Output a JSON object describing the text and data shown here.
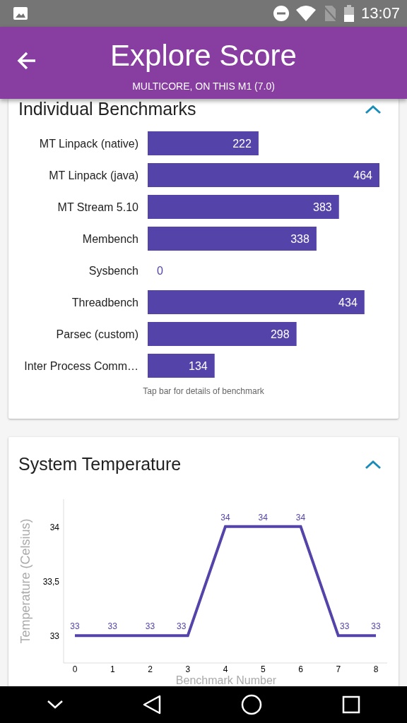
{
  "status_bar": {
    "time": "13:07"
  },
  "app_bar": {
    "title": "Explore Score",
    "subtitle": "MULTICORE, ON THIS M1 (7.0)"
  },
  "benchmarks_card": {
    "title": "Individual Benchmarks",
    "expanded": true,
    "chart_data": {
      "type": "bar",
      "orientation": "horizontal",
      "categories": [
        "MT Linpack (native)",
        "MT Linpack (java)",
        "MT Stream 5.10",
        "Membench",
        "Sysbench",
        "Threadbench",
        "Parsec (custom)",
        "Inter Process Comm…"
      ],
      "series": [
        {
          "color": "#5443a9",
          "values": [
            222,
            464,
            383,
            338,
            0,
            434,
            298,
            134
          ]
        }
      ],
      "data_labels": true
    },
    "caption": "Tap bar for details of benchmark"
  },
  "temperature_card": {
    "title": "System Temperature",
    "expanded": true,
    "chart_data": {
      "type": "line",
      "xlabel": "Benchmark Number",
      "ylabel": "Temperature (Celsius)",
      "x": [
        0,
        1,
        2,
        3,
        4,
        5,
        6,
        7,
        8
      ],
      "series": [
        {
          "color": "#5443a9",
          "values": [
            33,
            33,
            33,
            33,
            34,
            34,
            34,
            33,
            33
          ]
        }
      ],
      "xlim": [
        -0.3,
        8.3
      ],
      "ylim": [
        32.75,
        34.25
      ],
      "xticks": [
        0,
        1,
        2,
        3,
        4,
        5,
        6,
        7,
        8
      ],
      "yticks": [
        33,
        {
          "value": 33.5,
          "label": "33,5"
        },
        34
      ],
      "data_labels": true
    }
  }
}
